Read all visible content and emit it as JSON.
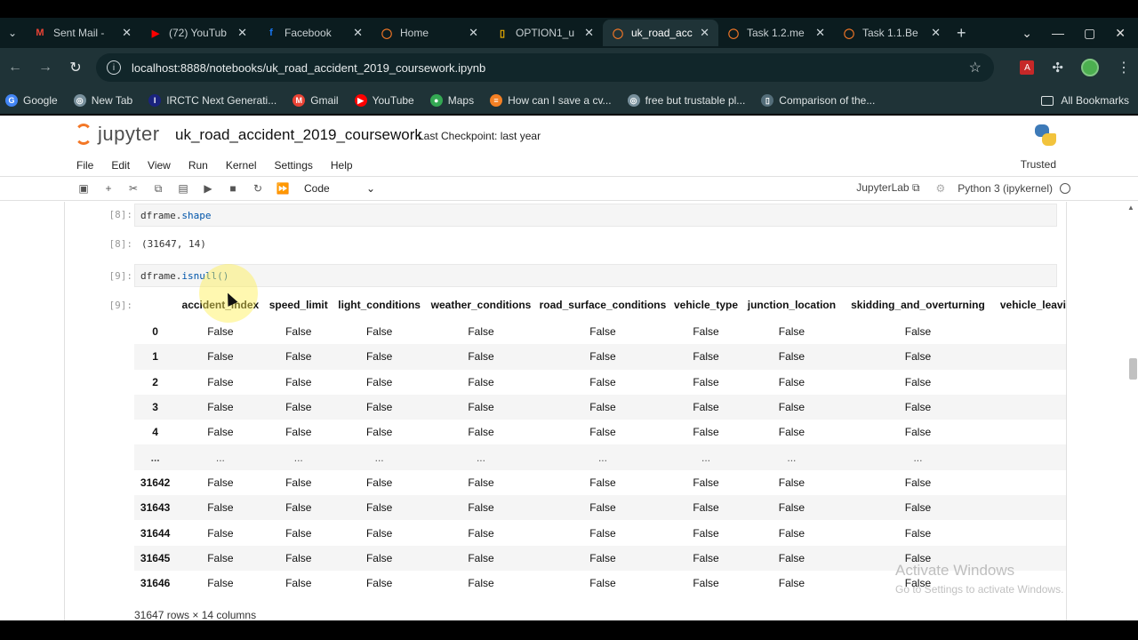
{
  "browser": {
    "tabs": [
      {
        "title": "Sent Mail -",
        "icon": "gmail-icon",
        "icon_text": "M",
        "icon_color": "#ea4335"
      },
      {
        "title": "(72) YouTub",
        "icon": "youtube-icon",
        "icon_text": "▶",
        "icon_color": "#ff0000"
      },
      {
        "title": "Facebook",
        "icon": "facebook-icon",
        "icon_text": "f",
        "icon_color": "#1877f2"
      },
      {
        "title": "Home",
        "icon": "jupyter-icon",
        "icon_text": "◯",
        "icon_color": "#f37726"
      },
      {
        "title": "OPTION1_u",
        "icon": "document-icon",
        "icon_text": "▯",
        "icon_color": "#f4b400"
      },
      {
        "title": "uk_road_acc",
        "icon": "jupyter-icon",
        "icon_text": "◯",
        "icon_color": "#f37726"
      },
      {
        "title": "Task 1.2.me",
        "icon": "jupyter-icon",
        "icon_text": "◯",
        "icon_color": "#f37726"
      },
      {
        "title": "Task 1.1.Be",
        "icon": "jupyter-icon",
        "icon_text": "◯",
        "icon_color": "#f37726"
      }
    ],
    "active_tab_index": 5,
    "url": "localhost:8888/notebooks/uk_road_accident_2019_coursework.ipynb",
    "bookmarks": [
      {
        "label": "Google",
        "icon": "google-icon",
        "icon_text": "G",
        "icon_color": "#4285f4"
      },
      {
        "label": "New Tab",
        "icon": "globe-icon",
        "icon_text": "◎",
        "icon_color": "#78909c"
      },
      {
        "label": "IRCTC Next Generati...",
        "icon": "irctc-icon",
        "icon_text": "I",
        "icon_color": "#1a237e"
      },
      {
        "label": "Gmail",
        "icon": "gmail-icon",
        "icon_text": "M",
        "icon_color": "#ea4335"
      },
      {
        "label": "YouTube",
        "icon": "youtube-icon",
        "icon_text": "▶",
        "icon_color": "#ff0000"
      },
      {
        "label": "Maps",
        "icon": "maps-icon",
        "icon_text": "●",
        "icon_color": "#34a853"
      },
      {
        "label": "How can I save a cv...",
        "icon": "stackoverflow-icon",
        "icon_text": "≡",
        "icon_color": "#f48024"
      },
      {
        "label": "free but trustable pl...",
        "icon": "globe-icon",
        "icon_text": "◎",
        "icon_color": "#78909c"
      },
      {
        "label": "Comparison of the...",
        "icon": "page-icon",
        "icon_text": "▯",
        "icon_color": "#546e7a"
      }
    ],
    "all_bookmarks": "All Bookmarks"
  },
  "jupyter": {
    "logo_text": "jupyter",
    "notebook_title": "uk_road_accident_2019_coursework",
    "checkpoint": "Last Checkpoint: last year",
    "menu": [
      "File",
      "Edit",
      "View",
      "Run",
      "Kernel",
      "Settings",
      "Help"
    ],
    "trusted": "Trusted",
    "cell_type": "Code",
    "jupyterlab_link": "JupyterLab",
    "kernel": "Python 3 (ipykernel)"
  },
  "cells": {
    "c1_in_prompt": "[8]:",
    "c1_code_obj": "dframe.",
    "c1_code_call": "shape",
    "c1_out_prompt": "[8]:",
    "c1_output": "(31647, 14)",
    "c2_in_prompt": "[9]:",
    "c2_code_obj": "dframe.",
    "c2_code_call": "isnull()",
    "c2_out_prompt": "[9]:"
  },
  "dataframe": {
    "columns": [
      "",
      "accident_index",
      "speed_limit",
      "light_conditions",
      "weather_conditions",
      "road_surface_conditions",
      "vehicle_type",
      "junction_location",
      "skidding_and_overturning",
      "vehicle_leavi"
    ],
    "rows": [
      [
        "0",
        "False",
        "False",
        "False",
        "False",
        "False",
        "False",
        "False",
        "False",
        ""
      ],
      [
        "1",
        "False",
        "False",
        "False",
        "False",
        "False",
        "False",
        "False",
        "False",
        ""
      ],
      [
        "2",
        "False",
        "False",
        "False",
        "False",
        "False",
        "False",
        "False",
        "False",
        ""
      ],
      [
        "3",
        "False",
        "False",
        "False",
        "False",
        "False",
        "False",
        "False",
        "False",
        ""
      ],
      [
        "4",
        "False",
        "False",
        "False",
        "False",
        "False",
        "False",
        "False",
        "False",
        ""
      ],
      [
        "...",
        "...",
        "...",
        "...",
        "...",
        "...",
        "...",
        "...",
        "...",
        ""
      ],
      [
        "31642",
        "False",
        "False",
        "False",
        "False",
        "False",
        "False",
        "False",
        "False",
        ""
      ],
      [
        "31643",
        "False",
        "False",
        "False",
        "False",
        "False",
        "False",
        "False",
        "False",
        ""
      ],
      [
        "31644",
        "False",
        "False",
        "False",
        "False",
        "False",
        "False",
        "False",
        "False",
        ""
      ],
      [
        "31645",
        "False",
        "False",
        "False",
        "False",
        "False",
        "False",
        "False",
        "False",
        ""
      ],
      [
        "31646",
        "False",
        "False",
        "False",
        "False",
        "False",
        "False",
        "False",
        "False",
        ""
      ]
    ],
    "shape_text": "31647 rows × 14 columns"
  },
  "watermark": {
    "line1": "Activate Windows",
    "line2": "Go to Settings to activate Windows."
  }
}
